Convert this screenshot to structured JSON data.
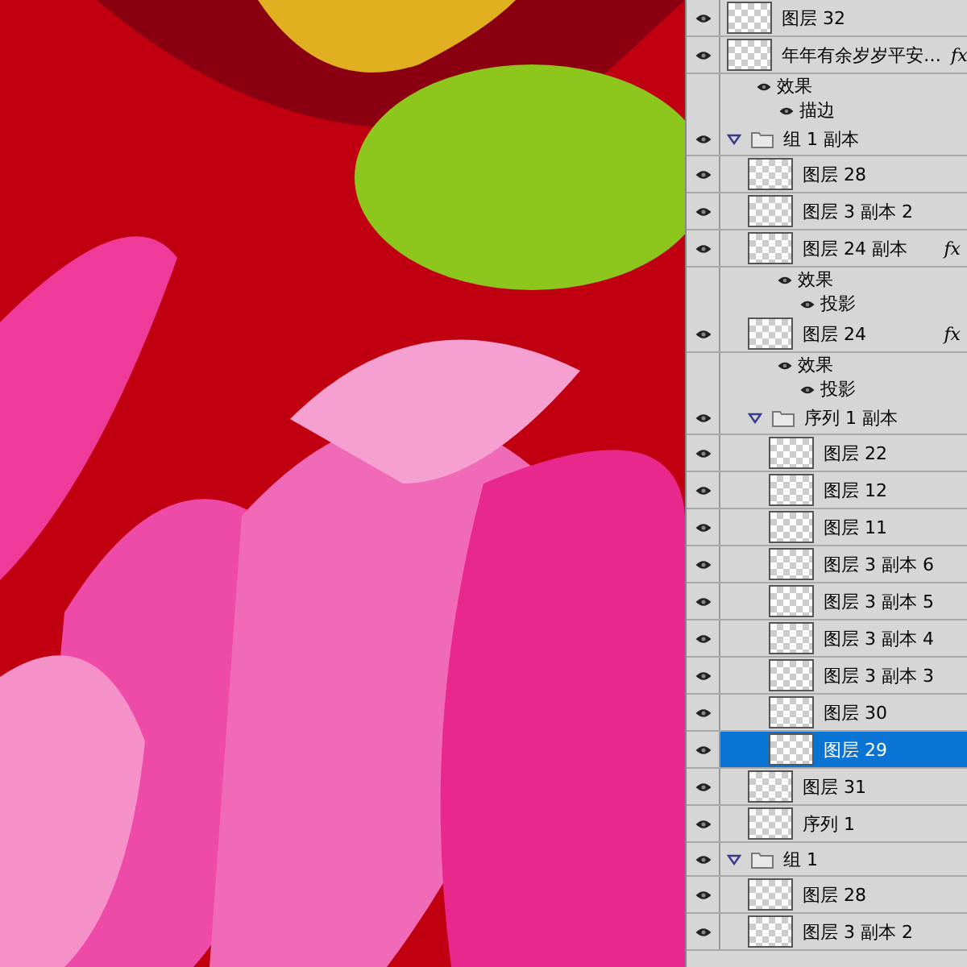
{
  "layers": [
    {
      "kind": "layer",
      "name": "图层 32",
      "visible": true,
      "selected": false
    },
    {
      "kind": "layer",
      "name": "年年有余岁岁平安…",
      "visible": true,
      "selected": false,
      "fx": "fx",
      "effects": {
        "label": "效果",
        "items": [
          "描边"
        ]
      }
    },
    {
      "kind": "group",
      "name": "组 1 副本",
      "visible": true,
      "selected": false,
      "expanded": true,
      "children": [
        {
          "kind": "layer",
          "name": "图层 28",
          "visible": true,
          "selected": false
        },
        {
          "kind": "layer",
          "name": "图层 3 副本 2",
          "visible": true,
          "selected": false
        },
        {
          "kind": "layer",
          "name": "图层 24 副本",
          "visible": true,
          "selected": false,
          "fx": "fx",
          "effects": {
            "label": "效果",
            "items": [
              "投影"
            ]
          }
        },
        {
          "kind": "layer",
          "name": "图层 24",
          "visible": true,
          "selected": false,
          "fx": "fx",
          "effects": {
            "label": "效果",
            "items": [
              "投影"
            ]
          }
        },
        {
          "kind": "group",
          "name": "序列 1 副本",
          "visible": true,
          "selected": false,
          "expanded": true,
          "children": [
            {
              "kind": "layer",
              "name": "图层 22",
              "visible": true,
              "selected": false
            },
            {
              "kind": "layer",
              "name": "图层 12",
              "visible": true,
              "selected": false
            },
            {
              "kind": "layer",
              "name": "图层 11",
              "visible": true,
              "selected": false
            },
            {
              "kind": "layer",
              "name": "图层 3 副本 6",
              "visible": true,
              "selected": false
            },
            {
              "kind": "layer",
              "name": "图层 3 副本 5",
              "visible": true,
              "selected": false
            },
            {
              "kind": "layer",
              "name": "图层 3 副本 4",
              "visible": true,
              "selected": false
            },
            {
              "kind": "layer",
              "name": "图层 3 副本 3",
              "visible": true,
              "selected": false
            },
            {
              "kind": "layer",
              "name": "图层 30",
              "visible": true,
              "selected": false
            },
            {
              "kind": "layer",
              "name": "图层 29",
              "visible": true,
              "selected": true
            }
          ]
        },
        {
          "kind": "layer",
          "name": "图层 31",
          "visible": true,
          "selected": false
        },
        {
          "kind": "layer",
          "name": "序列 1",
          "visible": true,
          "selected": false
        }
      ]
    },
    {
      "kind": "group",
      "name": "组 1",
      "visible": true,
      "selected": false,
      "expanded": true,
      "children": [
        {
          "kind": "layer",
          "name": "图层 28",
          "visible": true,
          "selected": false
        },
        {
          "kind": "layer",
          "name": "图层 3 副本 2",
          "visible": true,
          "selected": false
        }
      ]
    }
  ]
}
